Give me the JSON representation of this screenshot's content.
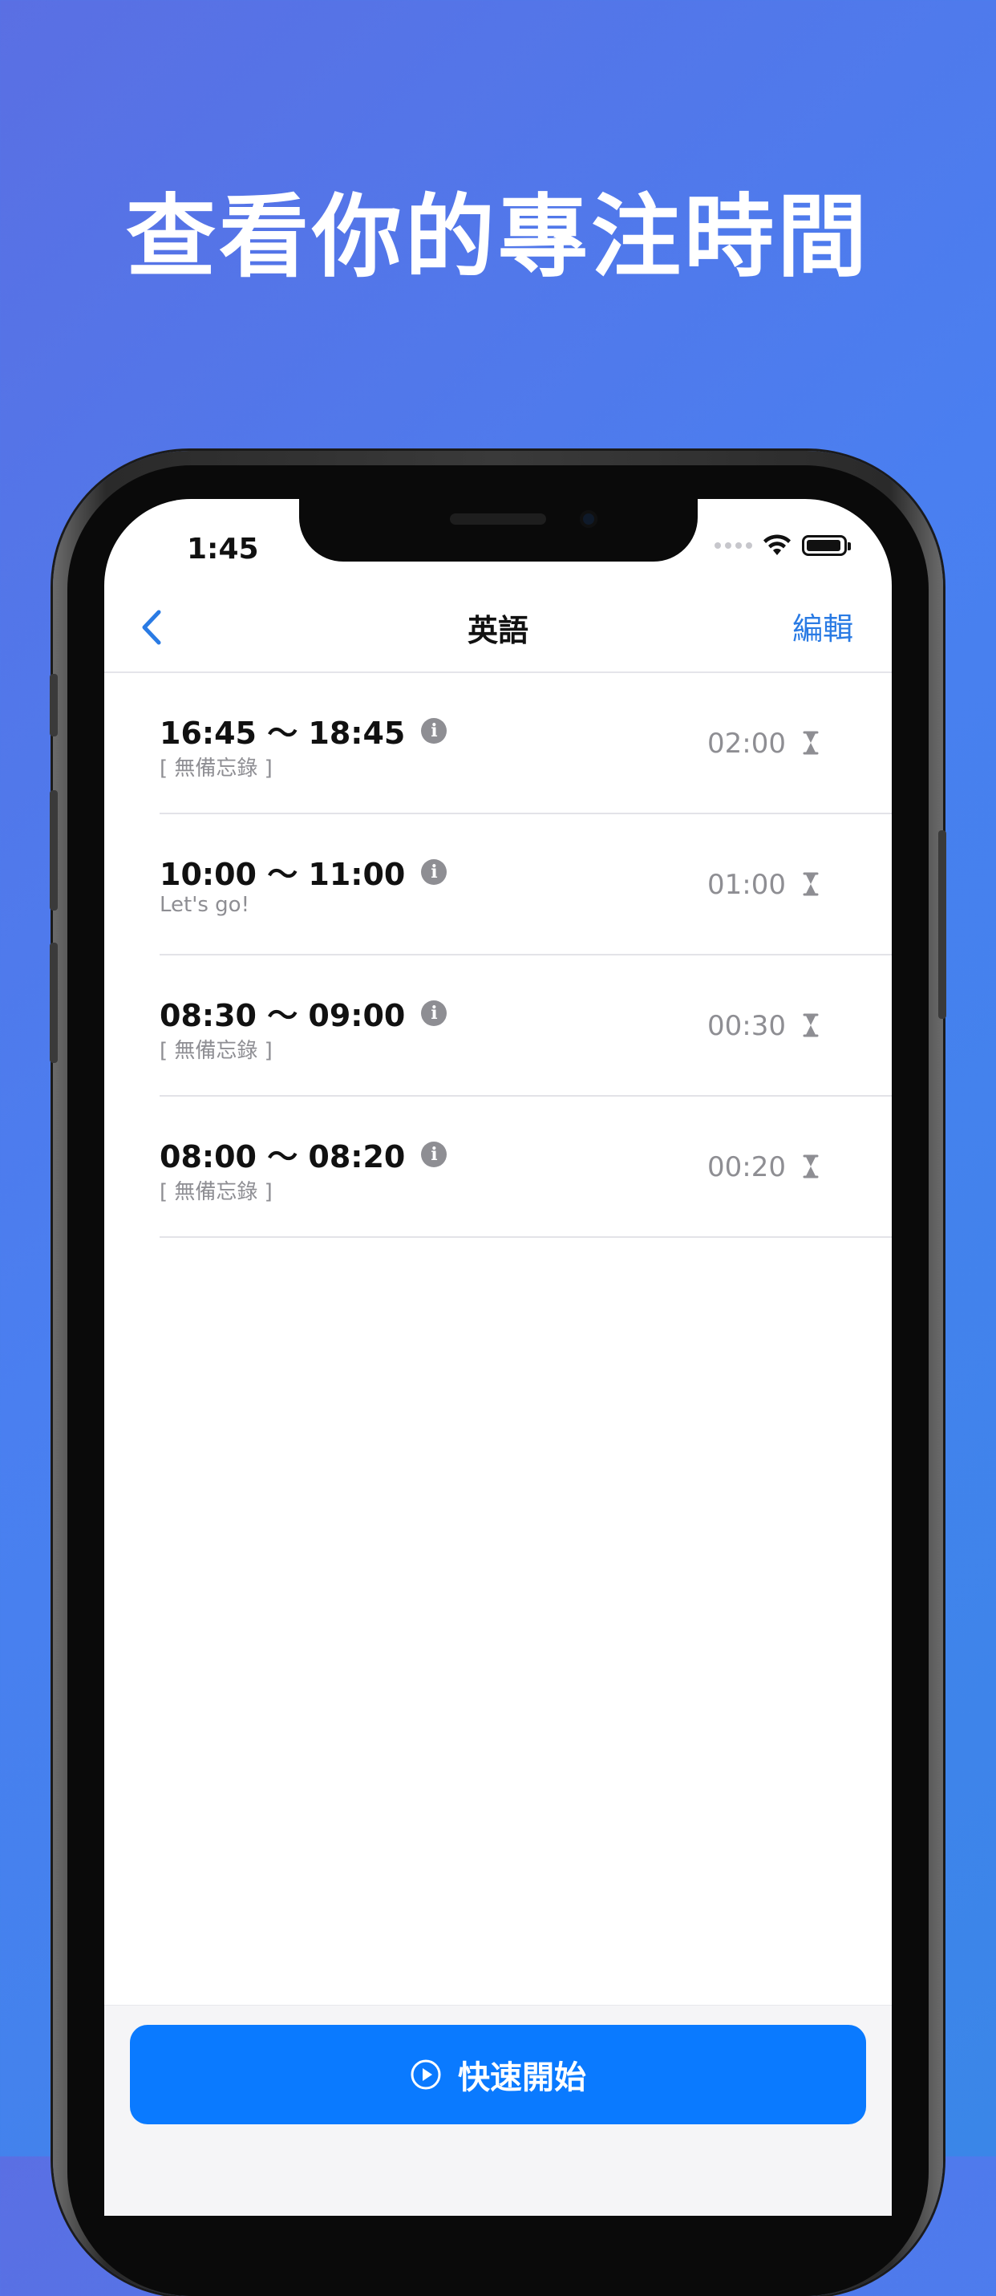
{
  "headline": "查看你的專注時間",
  "status_bar": {
    "time": "1:45"
  },
  "nav": {
    "title": "英語",
    "edit_label": "編輯"
  },
  "sessions": [
    {
      "range": "16:45 ～ 18:45",
      "memo": "[ 無備忘錄 ]",
      "duration": "02:00"
    },
    {
      "range": "10:00 ～ 11:00",
      "memo": "Let's go!",
      "duration": "01:00"
    },
    {
      "range": "08:30 ～ 09:00",
      "memo": "[ 無備忘錄 ]",
      "duration": "00:30"
    },
    {
      "range": "08:00 ～ 08:20",
      "memo": "[ 無備忘錄 ]",
      "duration": "00:20"
    }
  ],
  "bottom": {
    "start_label": "快速開始"
  },
  "icons": {
    "back": "chevron-left-icon",
    "info": "info-icon",
    "duration": "hourglass-icon",
    "start": "play-circle-icon",
    "wifi": "wifi-icon",
    "battery": "battery-icon"
  },
  "colors": {
    "accent": "#0a7aff",
    "link": "#2a7be4",
    "secondary_text": "#8e8e93",
    "background_gradient_start": "#5a6fe3",
    "background_gradient_end": "#3a86e8"
  }
}
